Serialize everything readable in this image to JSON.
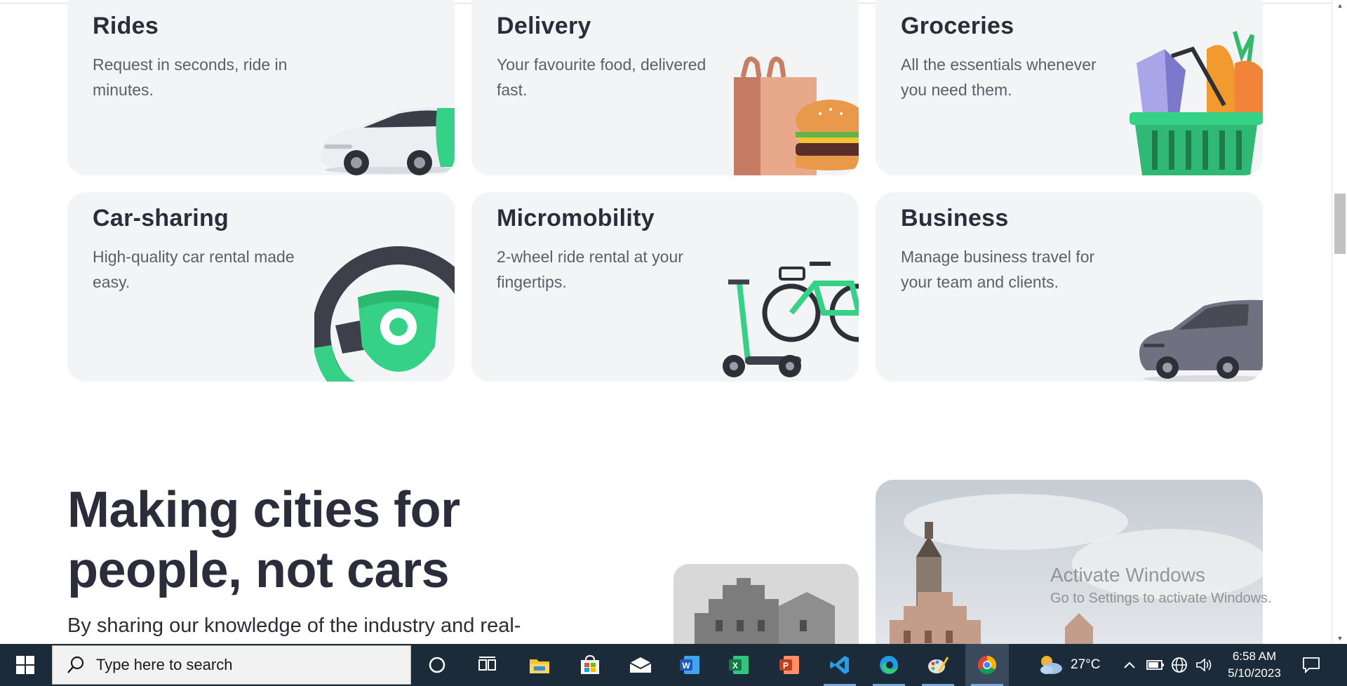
{
  "cards": [
    {
      "title": "Rides",
      "description": "Request in seconds, ride in minutes."
    },
    {
      "title": "Delivery",
      "description": "Your favourite food, delivered fast."
    },
    {
      "title": "Groceries",
      "description": "All the essentials whenever you need them."
    },
    {
      "title": "Car-sharing",
      "description": "High-quality car rental made easy."
    },
    {
      "title": "Micromobility",
      "description": "2-wheel ride rental at your fingertips."
    },
    {
      "title": "Business",
      "description": "Manage business travel for your team and clients."
    }
  ],
  "hero": {
    "title": "Making cities for people, not cars",
    "text": "By sharing our knowledge of the industry and real-"
  },
  "watermark": {
    "title": "Activate Windows",
    "subtitle": "Go to Settings to activate Windows."
  },
  "taskbar": {
    "search_placeholder": "Type here to search",
    "apps": [
      "cortana-icon",
      "task-view-icon",
      "file-explorer-icon",
      "microsoft-store-icon",
      "mail-icon",
      "word-icon",
      "excel-icon",
      "powerpoint-icon",
      "vscode-icon",
      "edge-icon",
      "paint-icon",
      "chrome-icon"
    ],
    "weather": "27°C",
    "time": "6:58 AM",
    "date": "5/10/2023"
  },
  "colors": {
    "brand_green": "#34d186",
    "card_bg": "#f3f4f6",
    "heading": "#2b2d3a",
    "taskbar": "#1c2b3a"
  }
}
